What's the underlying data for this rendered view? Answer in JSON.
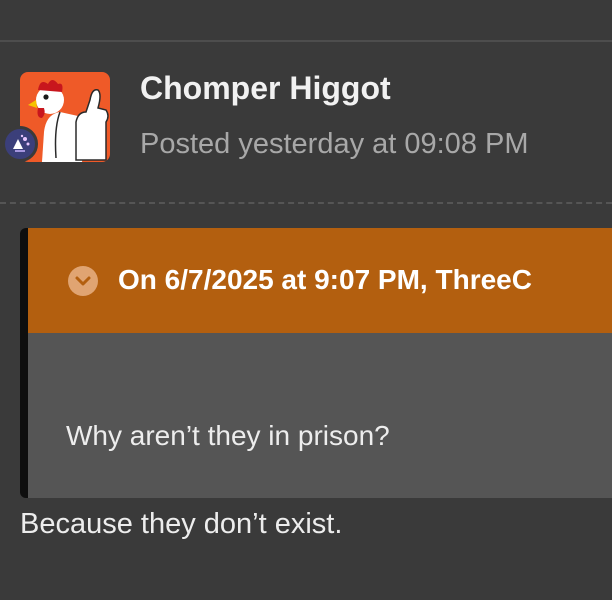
{
  "post": {
    "author": "Chomper Higgot",
    "posted": "Posted yesterday at 09:08 PM"
  },
  "quote": {
    "citation": "On 6/7/2025 at 9:07 PM, ThreeC",
    "body": "Why aren’t they in prison?"
  },
  "reply": {
    "text": "Because they don’t exist."
  },
  "icons": {
    "avatar": "chicken-thumbs-up-avatar",
    "badge": "rank-badge-icon",
    "quote_toggle": "chevron-down-icon"
  },
  "colors": {
    "background": "#3a3a3a",
    "quote_header": "#b35f0f",
    "quote_body_bg": "#555555",
    "avatar_bg": "#ef5a28"
  }
}
